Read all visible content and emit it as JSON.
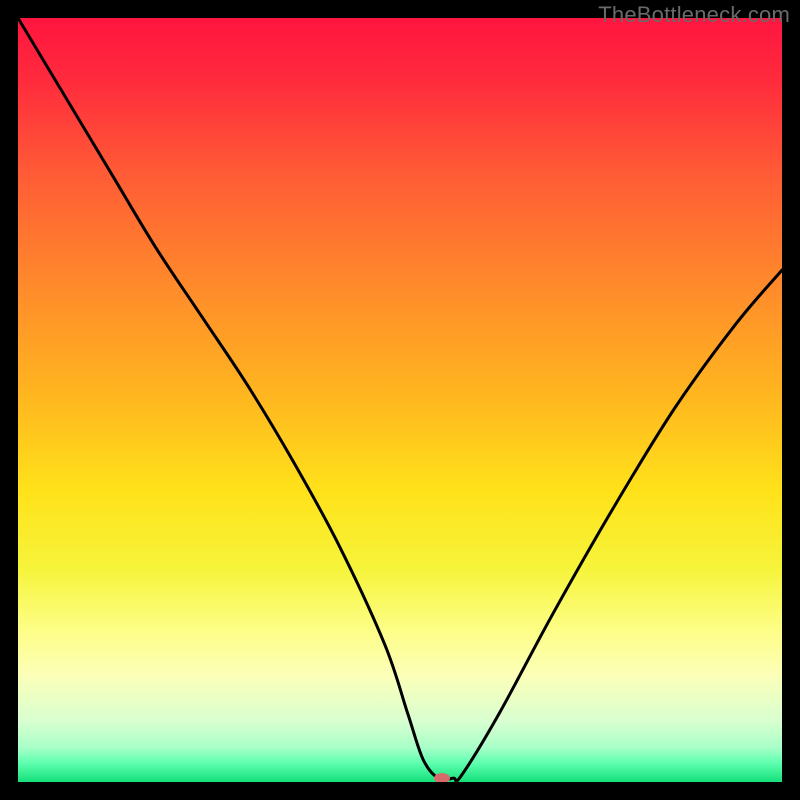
{
  "watermark": "TheBottleneck.com",
  "chart_data": {
    "type": "line",
    "title": "",
    "xlabel": "",
    "ylabel": "",
    "xlim": [
      0,
      100
    ],
    "ylim": [
      0,
      100
    ],
    "gradient_stops": [
      {
        "offset": 0.0,
        "color": "#ff153f"
      },
      {
        "offset": 0.08,
        "color": "#ff2a3d"
      },
      {
        "offset": 0.2,
        "color": "#ff5a36"
      },
      {
        "offset": 0.35,
        "color": "#ff8a2b"
      },
      {
        "offset": 0.5,
        "color": "#ffb81f"
      },
      {
        "offset": 0.62,
        "color": "#ffe21a"
      },
      {
        "offset": 0.72,
        "color": "#f6f43a"
      },
      {
        "offset": 0.8,
        "color": "#fdfe85"
      },
      {
        "offset": 0.86,
        "color": "#fcffb8"
      },
      {
        "offset": 0.92,
        "color": "#d9ffd0"
      },
      {
        "offset": 0.955,
        "color": "#a8ffc8"
      },
      {
        "offset": 0.975,
        "color": "#5fffb0"
      },
      {
        "offset": 1.0,
        "color": "#14e07a"
      }
    ],
    "series": [
      {
        "name": "bottleneck-curve",
        "x": [
          0,
          6,
          12,
          18,
          24,
          30,
          36,
          42,
          48,
          51,
          53,
          55,
          57,
          58,
          63,
          70,
          78,
          86,
          94,
          100
        ],
        "y": [
          100,
          90,
          80,
          70,
          61,
          52,
          42,
          31,
          18,
          9,
          3,
          0.5,
          0.5,
          0.8,
          9,
          22,
          36,
          49,
          60,
          67
        ]
      }
    ],
    "marker": {
      "name": "optimal-marker",
      "x": 55.5,
      "y": 0.5,
      "color": "#d66a6a",
      "rx": 8,
      "ry": 5
    },
    "annotations": []
  }
}
